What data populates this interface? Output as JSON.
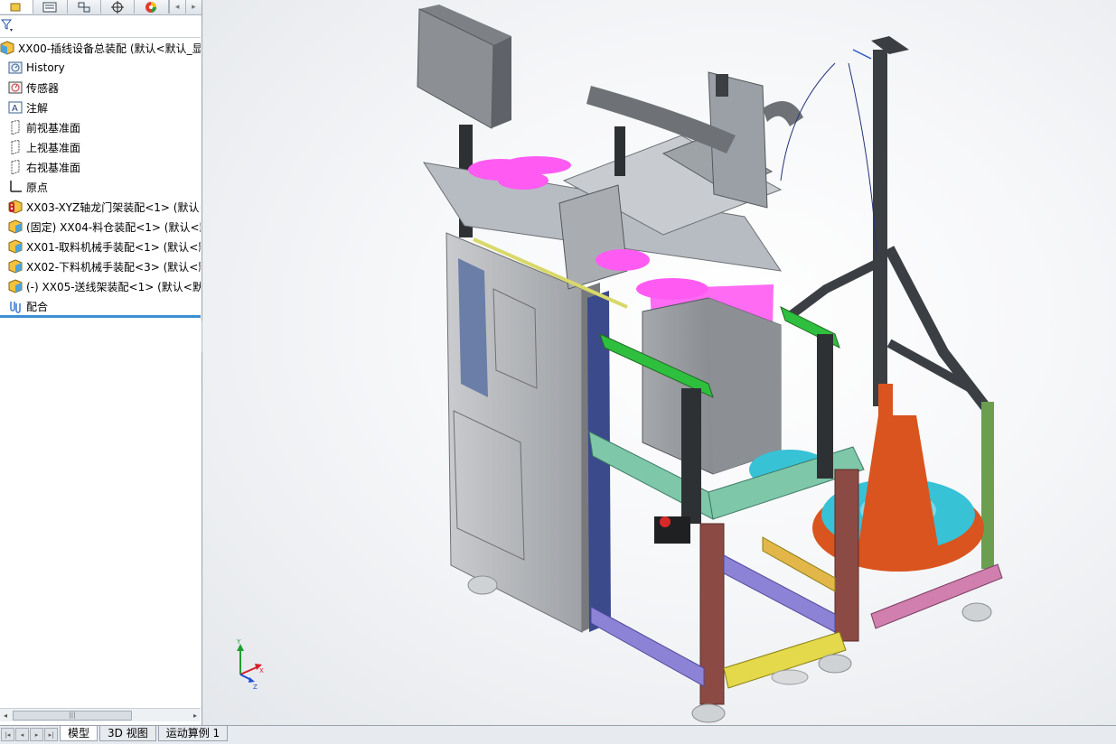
{
  "panel": {
    "tabs": [
      "feature-manager",
      "property-manager",
      "configuration-manager",
      "dim-xpert",
      "display-manager"
    ],
    "tree": [
      {
        "label": "XX00-插线设备总装配  (默认<默认_显示",
        "icon": "assembly-icon",
        "indent": 0
      },
      {
        "label": "History",
        "icon": "history-icon",
        "indent": 1
      },
      {
        "label": "传感器",
        "icon": "sensor-icon",
        "indent": 1
      },
      {
        "label": "注解",
        "icon": "annotation-icon",
        "indent": 1
      },
      {
        "label": "前视基准面",
        "icon": "plane-icon",
        "indent": 1
      },
      {
        "label": "上视基准面",
        "icon": "plane-icon",
        "indent": 1
      },
      {
        "label": "右视基准面",
        "icon": "plane-icon",
        "indent": 1
      },
      {
        "label": "原点",
        "icon": "origin-icon",
        "indent": 1
      },
      {
        "label": "XX03-XYZ轴龙门架装配<1> (默认<",
        "icon": "subassembly-warning-icon",
        "indent": 1
      },
      {
        "label": "(固定) XX04-料仓装配<1> (默认<默",
        "icon": "subassembly-icon",
        "indent": 1
      },
      {
        "label": "XX01-取料机械手装配<1> (默认<默",
        "icon": "subassembly-icon",
        "indent": 1
      },
      {
        "label": "XX02-下料机械手装配<3> (默认<默",
        "icon": "subassembly-icon",
        "indent": 1
      },
      {
        "label": "(-) XX05-送线架装配<1> (默认<默",
        "icon": "subassembly-icon",
        "indent": 1
      },
      {
        "label": "配合",
        "icon": "mates-icon",
        "indent": 1
      }
    ]
  },
  "bottom_tabs": [
    "模型",
    "3D 视图",
    "运动算例 1"
  ],
  "triad": {
    "x": "X",
    "y": "Y",
    "z": "Z"
  },
  "colors": {
    "frame_dark": "#3b3f44",
    "frame_green": "#2fbf3f",
    "frame_teal": "#7fc7a9",
    "frame_purple": "#8c83d6",
    "frame_red": "#8c4a45",
    "frame_yellow": "#e3d94a",
    "frame_pink": "#d17fae",
    "magenta": "#ff5bf2",
    "cone_orange": "#d9541e",
    "torus_cyan": "#37c2d6",
    "cabinet_gray": "#b8babd",
    "selection_blue": "#3c8fd1"
  }
}
